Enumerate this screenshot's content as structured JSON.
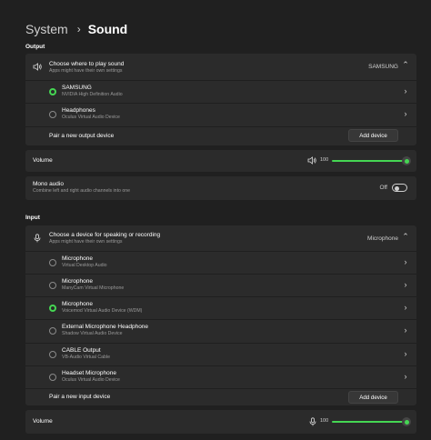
{
  "breadcrumb": {
    "parent": "System",
    "separator": "›",
    "current": "Sound"
  },
  "output": {
    "section_label": "Output",
    "chooser": {
      "title": "Choose where to play sound",
      "subtitle": "Apps might have their own settings",
      "value": "SAMSUNG"
    },
    "devices": [
      {
        "name": "SAMSUNG",
        "detail": "NVIDIA High Definition Audio",
        "selected": true
      },
      {
        "name": "Headphones",
        "detail": "Oculus Virtual Audio Device",
        "selected": false
      }
    ],
    "pair": {
      "label": "Pair a new output device",
      "button": "Add device"
    },
    "volume": {
      "label": "Volume",
      "value": "100",
      "level": 1.0
    },
    "mono": {
      "title": "Mono audio",
      "subtitle": "Combine left and right audio channels into one",
      "state_label": "Off",
      "on": false
    }
  },
  "input": {
    "section_label": "Input",
    "chooser": {
      "title": "Choose a device for speaking or recording",
      "subtitle": "Apps might have their own settings",
      "value": "Microphone"
    },
    "devices": [
      {
        "name": "Microphone",
        "detail": "Virtual Desktop Audio",
        "selected": false
      },
      {
        "name": "Microphone",
        "detail": "ManyCam Virtual Microphone",
        "selected": false
      },
      {
        "name": "Microphone",
        "detail": "Voicemod Virtual Audio Device (WDM)",
        "selected": true
      },
      {
        "name": "External Microphone Headphone",
        "detail": "Shadow Virtual Audio Device",
        "selected": false
      },
      {
        "name": "CABLE Output",
        "detail": "VB-Audio Virtual Cable",
        "selected": false
      },
      {
        "name": "Headset Microphone",
        "detail": "Oculus Virtual Audio Device",
        "selected": false
      }
    ],
    "pair": {
      "label": "Pair a new input device",
      "button": "Add device"
    },
    "volume": {
      "label": "Volume",
      "value": "100",
      "level": 1.0
    }
  },
  "icons": {
    "speaker": "speaker-icon",
    "microphone": "microphone-icon",
    "chevron": "chevron-right-icon",
    "chevron_glyph": "›"
  },
  "colors": {
    "accent": "#45d653",
    "background": "#202020",
    "card": "#2b2b2b"
  }
}
